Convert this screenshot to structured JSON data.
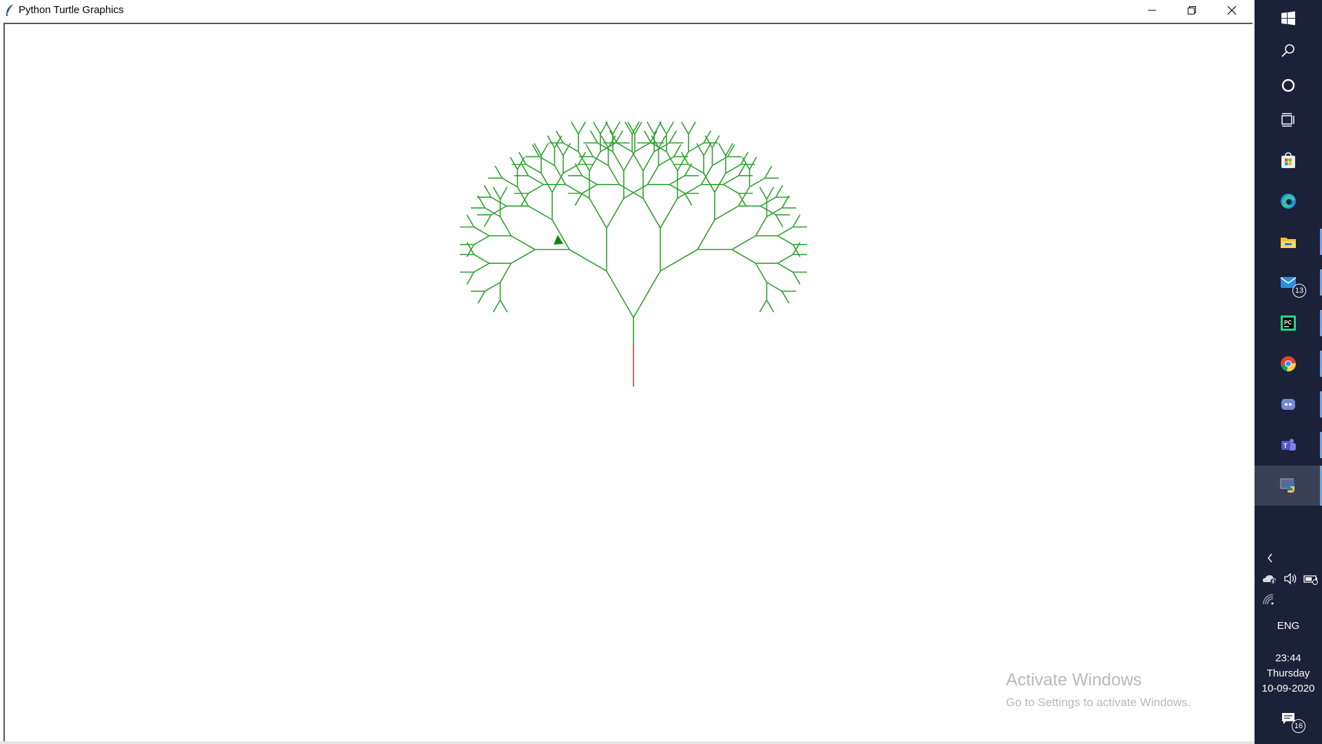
{
  "window": {
    "title": "Python Turtle Graphics",
    "controls": {
      "minimize": "minimize",
      "maximize": "restore",
      "close": "close"
    }
  },
  "turtle": {
    "trunk_color": "#d9363e",
    "branch_color": "#2ea02e",
    "cursor_color": "#0a8a0a",
    "recursion_depth": 7,
    "branch_angle_deg": 30
  },
  "watermark": {
    "title": "Activate Windows",
    "subtitle": "Go to Settings to activate Windows."
  },
  "taskbar": {
    "apps": [
      {
        "name": "windows-start-icon"
      },
      {
        "name": "search-icon"
      },
      {
        "name": "cortana-icon"
      },
      {
        "name": "task-view-icon"
      },
      {
        "name": "microsoft-store-icon"
      },
      {
        "name": "edge-icon"
      },
      {
        "name": "file-explorer-icon"
      },
      {
        "name": "mail-icon",
        "badge": "13"
      },
      {
        "name": "pycharm-icon"
      },
      {
        "name": "chrome-icon"
      },
      {
        "name": "discord-icon"
      },
      {
        "name": "teams-icon"
      },
      {
        "name": "python-turtle-icon",
        "active": true
      }
    ],
    "tray": {
      "language": "ENG",
      "time": "23:44",
      "day": "Thursday",
      "date": "10-09-2020",
      "notifications": "16"
    }
  }
}
